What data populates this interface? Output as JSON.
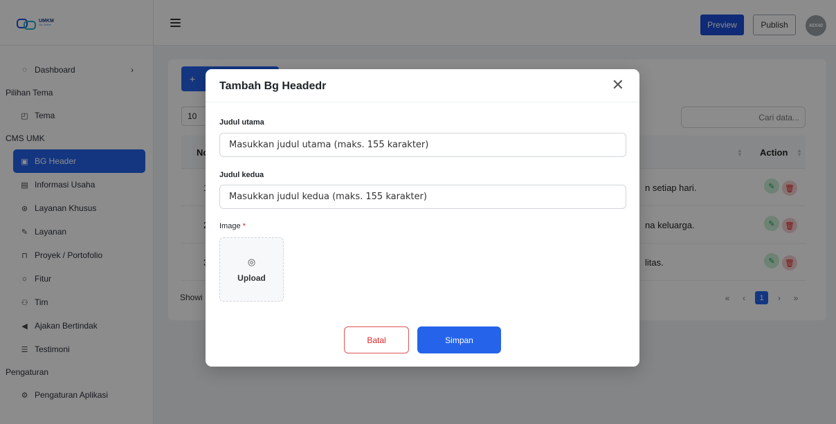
{
  "app": {
    "logo_text": "UMKM",
    "logo_sub": "Go Online"
  },
  "sidebar": {
    "items": [
      {
        "type": "item",
        "label": "Dashboard",
        "icon": "dashboard-icon",
        "has_chevron": true
      },
      {
        "type": "section",
        "label": "Pilihan Tema"
      },
      {
        "type": "item",
        "label": "Tema",
        "icon": "theme-icon"
      },
      {
        "type": "section",
        "label": "CMS UMK"
      },
      {
        "type": "item",
        "label": "BG Header",
        "icon": "image-icon",
        "active": true
      },
      {
        "type": "item",
        "label": "Informasi Usaha",
        "icon": "info-icon"
      },
      {
        "type": "item",
        "label": "Layanan Khusus",
        "icon": "special-service-icon"
      },
      {
        "type": "item",
        "label": "Layanan",
        "icon": "service-icon"
      },
      {
        "type": "item",
        "label": "Proyek / Portofolio",
        "icon": "portfolio-icon"
      },
      {
        "type": "item",
        "label": "Fitur",
        "icon": "feature-icon"
      },
      {
        "type": "item",
        "label": "Tim",
        "icon": "team-icon"
      },
      {
        "type": "item",
        "label": "Ajakan Bertindak",
        "icon": "megaphone-icon"
      },
      {
        "type": "item",
        "label": "Testimoni",
        "icon": "testimonial-icon"
      },
      {
        "type": "section",
        "label": "Pengaturan"
      },
      {
        "type": "item",
        "label": "Pengaturan Aplikasi",
        "icon": "settings-icon"
      }
    ]
  },
  "header": {
    "preview_label": "Preview",
    "publish_label": "Publish",
    "avatar_text": "40X40"
  },
  "content": {
    "add_button_label": "+",
    "page_length": "10",
    "search_placeholder": "Cari data...",
    "columns": {
      "no": "No",
      "action": "Action"
    },
    "rows": [
      {
        "no": "1",
        "text": "n setiap hari."
      },
      {
        "no": "2",
        "text": "na keluarga."
      },
      {
        "no": "3",
        "text": "litas."
      }
    ],
    "showing_text": "Showi",
    "pagination": {
      "first": "«",
      "prev": "‹",
      "current": "1",
      "next": "›",
      "last": "»"
    }
  },
  "modal": {
    "title": "Tambah Bg Headedr",
    "close_symbol": "✕",
    "field1_label": "Judul utama",
    "field1_placeholder": "Masukkan judul utama (maks. 155 karakter)",
    "field2_label": "Judul kedua",
    "field2_placeholder": "Masukkan judul kedua (maks. 155 karakter)",
    "image_label": "Image",
    "required_mark": "*",
    "upload_label": "Upload",
    "cancel_label": "Batal",
    "save_label": "Simpan"
  },
  "colors": {
    "primary": "#2563eb",
    "danger": "#dc2626",
    "success": "#16a34a"
  }
}
